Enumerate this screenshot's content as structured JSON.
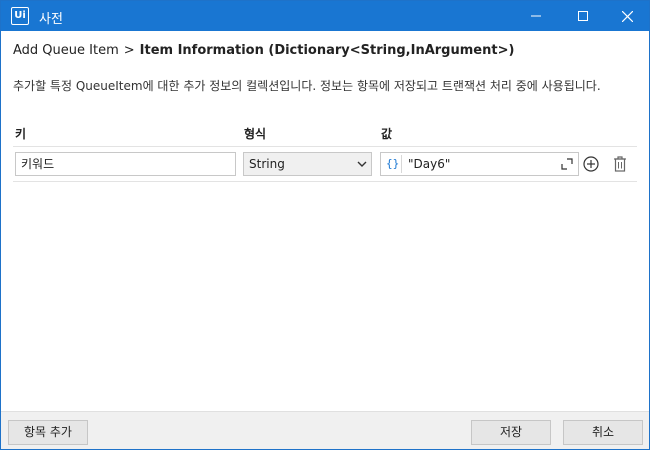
{
  "window": {
    "title": "사전",
    "app_icon_text": "Ui",
    "controls": {
      "minimize": "minimize-icon",
      "maximize": "maximize-icon",
      "close": "close-icon"
    }
  },
  "breadcrumb": {
    "parent": "Add Queue Item",
    "separator": ">",
    "current": "Item Information (Dictionary<String,InArgument>)"
  },
  "description": "추가할 특정 QueueItem에 대한 추가 정보의 컬렉션입니다. 정보는 항목에 저장되고 트랜잭션 처리 중에 사용됩니다.",
  "table": {
    "headers": {
      "key": "키",
      "type": "형식",
      "value": "값"
    },
    "rows": [
      {
        "key": "키워드",
        "type": "String",
        "value_prefix": "{}",
        "value": "\"Day6\""
      }
    ]
  },
  "footer": {
    "add_item": "항목 추가",
    "save": "저장",
    "cancel": "취소"
  },
  "colors": {
    "accent": "#1976d2",
    "titlebar": "#1976d2"
  }
}
